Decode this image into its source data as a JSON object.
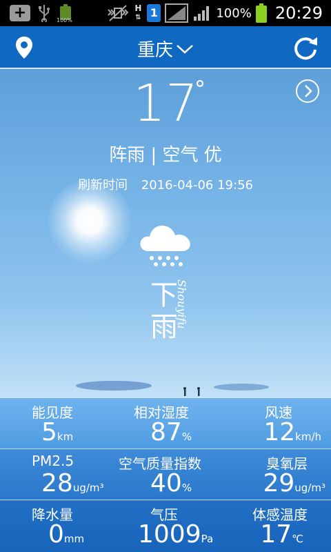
{
  "status_bar": {
    "small_battery_pct": "100%",
    "network_h": "H",
    "sim_label": "1",
    "battery_pct": "100%",
    "time": "20:29"
  },
  "header": {
    "city": "重庆"
  },
  "weather": {
    "temperature": "17",
    "degree_symbol": "°",
    "condition": "阵雨",
    "separator": "|",
    "air_quality_label": "空气",
    "air_quality_value": "优",
    "refresh_label": "刷新时间",
    "refresh_time": "2016-04-06 19:56",
    "big_char_1": "下",
    "big_char_2": "雨",
    "script_text": "Shouyifu"
  },
  "details": {
    "rows": [
      [
        {
          "label": "能见度",
          "value": "5",
          "unit": "km"
        },
        {
          "label": "相对湿度",
          "value": "87",
          "unit": "%"
        },
        {
          "label": "风速",
          "value": "12",
          "unit": "km/h"
        }
      ],
      [
        {
          "label": "PM2.5",
          "value": "28",
          "unit": "ug/m³"
        },
        {
          "label": "空气质量指数",
          "value": "40",
          "unit": "%"
        },
        {
          "label": "臭氧层",
          "value": "29",
          "unit": "ug/m³"
        }
      ],
      [
        {
          "label": "降水量",
          "value": "0",
          "unit": "mm"
        },
        {
          "label": "气压",
          "value": "1009",
          "unit": "Pa"
        },
        {
          "label": "体感温度",
          "value": "17",
          "unit": "℃"
        }
      ]
    ]
  },
  "colors": {
    "header_bg": "#0f68c2",
    "status_bar_bg": "#000000",
    "battery_green": "#8cd020",
    "sim_blue": "#1a78d8"
  },
  "icons": {
    "location": "location-pin-icon",
    "dropdown": "chevron-down-icon",
    "refresh": "refresh-icon",
    "next": "chevron-right-circle-icon",
    "weather": "rain-cloud-icon"
  }
}
